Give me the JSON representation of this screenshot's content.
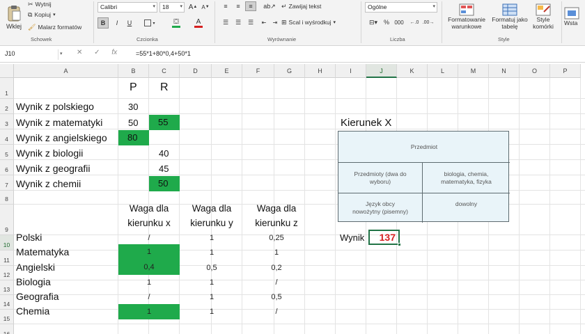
{
  "ribbon": {
    "clipboard": {
      "paste": "Wklej",
      "cut": "Wytnij",
      "copy": "Kopiuj",
      "format_painter": "Malarz formatów",
      "label": "Schowek"
    },
    "font": {
      "name": "Calibri",
      "size": "18",
      "label": "Czcionka",
      "bold": "B",
      "italic": "I",
      "underline": "U"
    },
    "alignment": {
      "wrap": "Zawijaj tekst",
      "merge": "Scal i wyśrodkuj",
      "label": "Wyrównanie"
    },
    "number": {
      "format": "Ogólne",
      "label": "Liczba"
    },
    "styles": {
      "conditional": "Formatowanie\nwarunkowe",
      "as_table": "Formatuj jako\ntabelę",
      "cell_styles": "Style\nkomórki",
      "label": "Style"
    },
    "cells": {
      "insert": "Wsta"
    }
  },
  "formula_bar": {
    "name_box": "J10",
    "formula": "=55*1+80*0,4+50*1",
    "fx": "fx"
  },
  "columns": [
    "A",
    "B",
    "C",
    "D",
    "E",
    "F",
    "G",
    "H",
    "I",
    "J",
    "K",
    "L",
    "M",
    "N",
    "O",
    "P"
  ],
  "rows": [
    "1",
    "2",
    "3",
    "4",
    "5",
    "6",
    "7",
    "8",
    "9",
    "10",
    "11",
    "12",
    "13",
    "14",
    "15",
    "16"
  ],
  "sheet": {
    "header_p": "P",
    "header_r": "R",
    "subjects": [
      {
        "label": "Wynik z polskiego",
        "p": "30",
        "r": ""
      },
      {
        "label": "Wynik z matematyki",
        "p": "50",
        "r": "55"
      },
      {
        "label": "Wynik z angielskiego",
        "p": "80",
        "r": ""
      },
      {
        "label": "Wynik z biologii",
        "p": "",
        "r": "40"
      },
      {
        "label": "Wynik z geografii",
        "p": "",
        "r": "45"
      },
      {
        "label": "Wynik z chemii",
        "p": "",
        "r": "50"
      }
    ],
    "weight_headers": {
      "x_line1": "Waga dla",
      "x_line2": "kierunku x",
      "y_line1": "Waga dla",
      "y_line2": "kierunku y",
      "z_line1": "Waga dla",
      "z_line2": "kierunku z"
    },
    "weights": [
      {
        "label": "Polski",
        "x": "/",
        "y": "1",
        "z": "0,25"
      },
      {
        "label": "Matematyka",
        "x": "1",
        "y": "1",
        "z": "1"
      },
      {
        "label": "Angielski",
        "x": "0,4",
        "y": "0,5",
        "z": "0,2"
      },
      {
        "label": "Biologia",
        "x": "1",
        "y": "1",
        "z": "/"
      },
      {
        "label": "Geografia",
        "x": "/",
        "y": "1",
        "z": "0,5"
      },
      {
        "label": "Chemia",
        "x": "1",
        "y": "1",
        "z": "/"
      }
    ],
    "kierunek_title": "Kierunek X",
    "table": {
      "header": "Przedmiot",
      "r1c1": "Przedmioty (dwa do\nwyboru)",
      "r1c2": "biologia, chemia,\nmatematyka, fizyka",
      "r2c1": "Język obcy\nnowożytny (pisemny)",
      "r2c2": "dowolny"
    },
    "wynik_label": "Wynik",
    "wynik_value": "137"
  },
  "colors": {
    "highlight_green": "#1faa4b",
    "result_red": "#d62020",
    "excel_green": "#217346"
  }
}
